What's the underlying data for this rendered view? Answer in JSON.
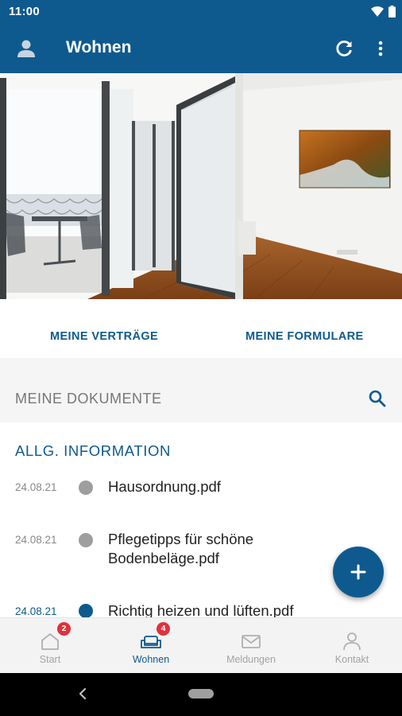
{
  "status_bar": {
    "time": "11:00"
  },
  "app_bar": {
    "title": "Wohnen"
  },
  "links": {
    "contracts": "MEINE VERTRÄGE",
    "forms": "MEINE FORMULARE"
  },
  "documents": {
    "header": "MEINE DOKUMENTE",
    "section_title": "ALLG. INFORMATION",
    "items": [
      {
        "date": "24.08.21",
        "name": "Hausordnung.pdf",
        "unread": false
      },
      {
        "date": "24.08.21",
        "name": "Pflegetipps für schöne Bodenbeläge.pdf",
        "unread": false
      },
      {
        "date": "24.08.21",
        "name": "Richtig heizen und lüften.pdf",
        "unread": true
      }
    ]
  },
  "bottom_nav": [
    {
      "label": "Start",
      "badge": "2",
      "icon": "home-icon",
      "active": false
    },
    {
      "label": "Wohnen",
      "badge": "4",
      "icon": "sofa-icon",
      "active": true
    },
    {
      "label": "Meldungen",
      "badge": "",
      "icon": "mail-icon",
      "active": false
    },
    {
      "label": "Kontakt",
      "badge": "",
      "icon": "person-icon",
      "active": false
    }
  ],
  "colors": {
    "primary": "#0e5a8f",
    "badge": "#e0313c",
    "read_dot": "#9e9e9e"
  }
}
